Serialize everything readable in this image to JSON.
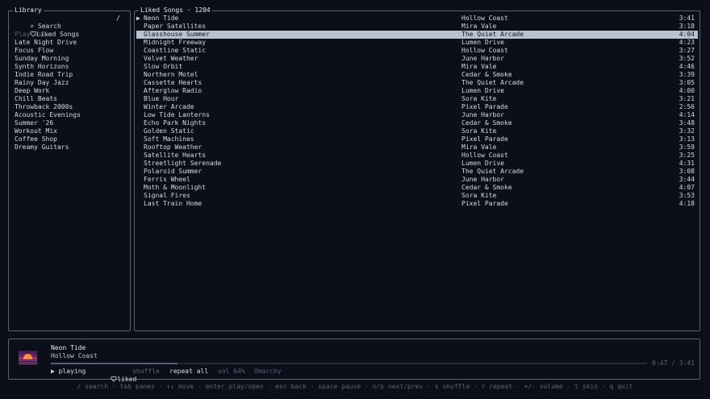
{
  "library": {
    "title": "Library",
    "search_label": "⌕ Search",
    "search_shortcut": "/",
    "liked_label": "Liked Songs",
    "playlists_header": "Playlists",
    "playlists": [
      "Late Night Drive",
      "Focus Flow",
      "Sunday Morning",
      "Synth Horizons",
      "Indie Road Trip",
      "Rainy Day Jazz",
      "Deep Work",
      "Chill Beats",
      "Throwback 2000s",
      "Acoustic Evenings",
      "Summer '26",
      "Workout Mix",
      "Coffee Shop",
      "Dreamy Guitars"
    ]
  },
  "songs": {
    "title": "Liked Songs · 1204",
    "selected_index": 2,
    "playing_index": 0,
    "playing_marker": "▶",
    "rows": [
      {
        "title": "Neon Tide",
        "artist": "Hollow Coast",
        "duration": "3:41"
      },
      {
        "title": "Paper Satellites",
        "artist": "Mira Vale",
        "duration": "3:18"
      },
      {
        "title": "Glasshouse Summer",
        "artist": "The Quiet Arcade",
        "duration": "4:04"
      },
      {
        "title": "Midnight Freeway",
        "artist": "Lumen Drive",
        "duration": "4:23"
      },
      {
        "title": "Coastline Static",
        "artist": "Hollow Coast",
        "duration": "3:27"
      },
      {
        "title": "Velvet Weather",
        "artist": "June Harbor",
        "duration": "3:52"
      },
      {
        "title": "Slow Orbit",
        "artist": "Mira Vale",
        "duration": "4:46"
      },
      {
        "title": "Northern Motel",
        "artist": "Cedar & Smoke",
        "duration": "3:39"
      },
      {
        "title": "Cassette Hearts",
        "artist": "The Quiet Arcade",
        "duration": "3:05"
      },
      {
        "title": "Afterglow Radio",
        "artist": "Lumen Drive",
        "duration": "4:00"
      },
      {
        "title": "Blue Hour",
        "artist": "Sora Kite",
        "duration": "3:21"
      },
      {
        "title": "Winter Arcade",
        "artist": "Pixel Parade",
        "duration": "2:56"
      },
      {
        "title": "Low Tide Lanterns",
        "artist": "June Harbor",
        "duration": "4:14"
      },
      {
        "title": "Echo Park Nights",
        "artist": "Cedar & Smoke",
        "duration": "3:48"
      },
      {
        "title": "Golden Static",
        "artist": "Sora Kite",
        "duration": "3:32"
      },
      {
        "title": "Soft Machines",
        "artist": "Pixel Parade",
        "duration": "3:13"
      },
      {
        "title": "Rooftop Weather",
        "artist": "Mira Vale",
        "duration": "3:59"
      },
      {
        "title": "Satellite Hearts",
        "artist": "Hollow Coast",
        "duration": "3:25"
      },
      {
        "title": "Streetlight Serenade",
        "artist": "Lumen Drive",
        "duration": "4:31"
      },
      {
        "title": "Polaroid Summer",
        "artist": "The Quiet Arcade",
        "duration": "3:08"
      },
      {
        "title": "Ferris Wheel",
        "artist": "June Harbor",
        "duration": "3:44"
      },
      {
        "title": "Moth & Moonlight",
        "artist": "Cedar & Smoke",
        "duration": "4:07"
      },
      {
        "title": "Signal Fires",
        "artist": "Sora Kite",
        "duration": "3:53"
      },
      {
        "title": "Last Train Home",
        "artist": "Pixel Parade",
        "duration": "4:18"
      }
    ]
  },
  "player": {
    "title": "Neon Tide",
    "artist": "Hollow Coast",
    "elapsed": "0:47",
    "duration": "3:41",
    "time_display": "0:47 / 3:41",
    "progress": 0.2127,
    "state_label": "▶ playing",
    "liked_label": "liked",
    "shuffle_label": "shuffle",
    "repeat_label": "repeat all",
    "volume_label": "vol 64%",
    "device_label": "Omarchy"
  },
  "help": "/ search · tab panes · ↑↓ move · enter play/open · esc back · space pause · n/p next/prev · s shuffle · r repeat · +/- volume · t skin · q quit",
  "colors": {
    "background": "#0a0f1a",
    "border": "#5b6370",
    "text": "#d7dbe3",
    "dim_text": "#5c6472",
    "selection_bg": "#b9c3cf"
  }
}
